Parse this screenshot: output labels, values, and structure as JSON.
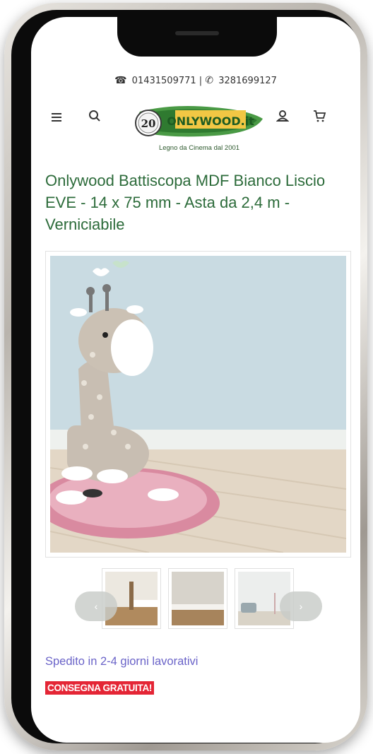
{
  "header": {
    "phone": "01431509771",
    "whatsapp": "3281699127",
    "logo_text": "ONLYWOOD.it",
    "logo_badge": "20",
    "tagline": "Legno da Cinema dal 2001"
  },
  "product": {
    "title": "Onlywood Battiscopa MDF Bianco Liscio EVE - 14 x 75 mm - Asta da 2,4 m - Verniciabile",
    "shipping": "Spedito in 2-4 giorni lavorativi",
    "delivery_badge": "CONSEGNA GRATUITA!"
  },
  "gallery": {
    "prev_label": "‹",
    "next_label": "›",
    "thumbnails": 3
  },
  "icons": {
    "phone": "☎",
    "whatsapp": "✆",
    "separator": "|"
  },
  "colors": {
    "title": "#2c6b3a",
    "shipping": "#6a63c8",
    "badge": "#e42535"
  }
}
